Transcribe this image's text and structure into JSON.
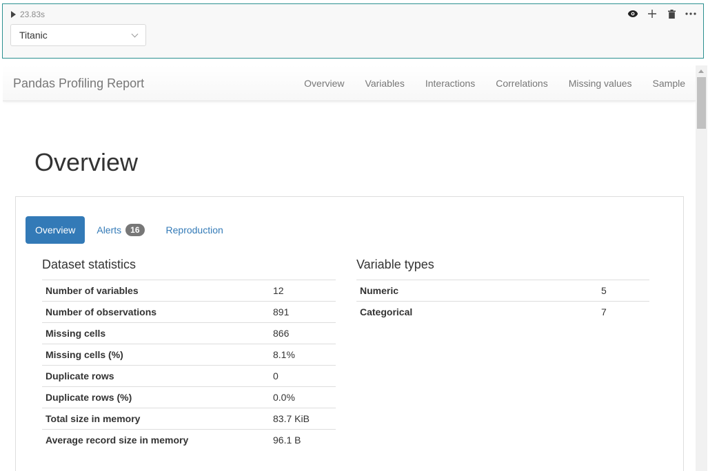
{
  "cell": {
    "exec_time": "23.83s",
    "dropdown_value": "Titanic"
  },
  "report": {
    "brand": "Pandas Profiling Report",
    "nav": [
      "Overview",
      "Variables",
      "Interactions",
      "Correlations",
      "Missing values",
      "Sample"
    ],
    "heading": "Overview",
    "tabs": {
      "overview": "Overview",
      "alerts": "Alerts",
      "alerts_count": "16",
      "reproduction": "Reproduction"
    },
    "dataset_statistics": {
      "title": "Dataset statistics",
      "rows": [
        {
          "label": "Number of variables",
          "value": "12"
        },
        {
          "label": "Number of observations",
          "value": "891"
        },
        {
          "label": "Missing cells",
          "value": "866"
        },
        {
          "label": "Missing cells (%)",
          "value": "8.1%"
        },
        {
          "label": "Duplicate rows",
          "value": "0"
        },
        {
          "label": "Duplicate rows (%)",
          "value": "0.0%"
        },
        {
          "label": "Total size in memory",
          "value": "83.7 KiB"
        },
        {
          "label": "Average record size in memory",
          "value": "96.1 B"
        }
      ]
    },
    "variable_types": {
      "title": "Variable types",
      "rows": [
        {
          "label": "Numeric",
          "value": "5"
        },
        {
          "label": "Categorical",
          "value": "7"
        }
      ]
    }
  }
}
